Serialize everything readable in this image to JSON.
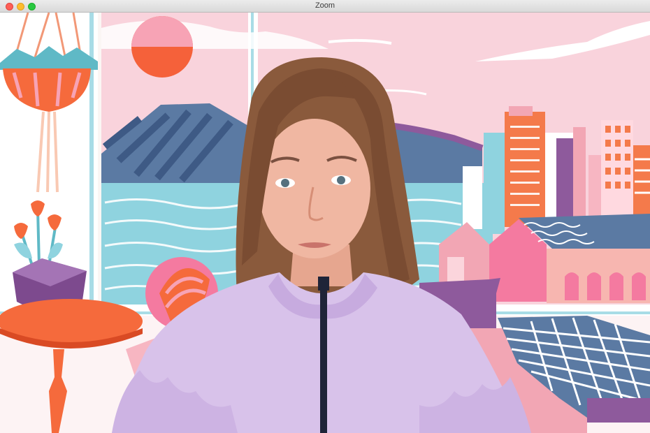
{
  "window": {
    "title": "Zoom",
    "controls": [
      "close-icon",
      "minimize-icon",
      "zoom-icon"
    ]
  },
  "colors": {
    "sky": "#f9d3dc",
    "sun_top": "#f7a3b5",
    "sun_bottom": "#f5613a",
    "water": "#8fd3df",
    "mountain": "#5b7aa3",
    "building_orange": "#f47a4b",
    "building_pink": "#f2a6b4",
    "purple": "#8e5a9c",
    "table": "#f56a3c",
    "jacket": "#d8c2ea",
    "hair": "#8a5a3c"
  }
}
